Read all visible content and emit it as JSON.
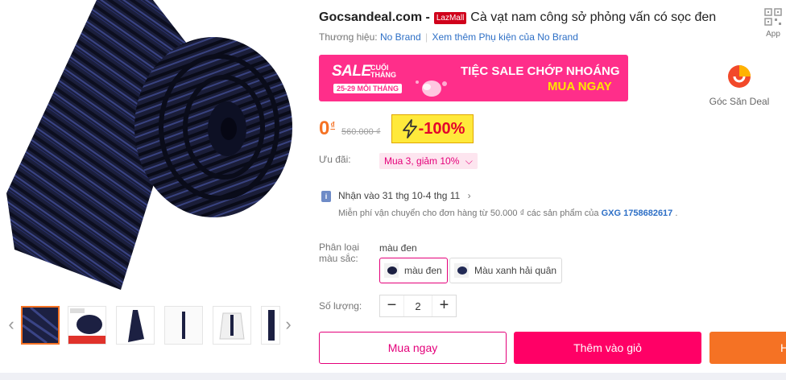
{
  "product": {
    "brand_name": "Gocsandeal.com -",
    "lazmall_badge": "LazMall",
    "title": "Cà vạt nam công sở phỏng vấn có sọc đen"
  },
  "app_shortcut": {
    "label": "App",
    "icon": "qr-code-icon"
  },
  "brand_row": {
    "label": "Thương hiệu:",
    "brand_link": "No Brand",
    "separator": "|",
    "more_link": "Xem thêm Phụ kiện của No Brand"
  },
  "banner": {
    "sale_word": "SALE",
    "sale_sub": "CUỐI THÁNG",
    "sale_date": "25-29 MỖI THÁNG",
    "headline": "TIỆC SALE CHỚP NHOÁNG",
    "cta": "MUA NGAY",
    "background_color": "#ff2e8a"
  },
  "seller": {
    "name": "Góc Săn Deal"
  },
  "price": {
    "current": "0",
    "currency": "₫",
    "original": "560.000 ₫",
    "discount": "-100%",
    "flash_icon": "lightning-icon"
  },
  "promotion": {
    "label": "Ưu đãi:",
    "chip": "Mua 3, giảm 10%"
  },
  "delivery": {
    "text": "Nhận vào 31 thg 10-4 thg 11",
    "shipping_prefix": "Miễn phí vận chuyển cho đơn hàng từ 50.000 ₫ các sản phẩm của",
    "shipping_code": "GXG 1758682617",
    "shipping_suffix": "."
  },
  "variants": {
    "label": "Phân loại màu sắc:",
    "selected_label": "màu đen",
    "options": [
      {
        "label": "màu đen",
        "selected": true
      },
      {
        "label": "Màu xanh hải quân",
        "selected": false
      }
    ]
  },
  "quantity": {
    "label": "Số lượng:",
    "value": "2",
    "minus": "−",
    "plus": "+"
  },
  "actions": {
    "buy_now": "Mua ngay",
    "add_to_cart": "Thêm vào giỏ",
    "extra": "H"
  },
  "colors": {
    "accent_pink": "#e4007a",
    "cart_pink": "#ff0066",
    "price_orange": "#f57224",
    "link_blue": "#2d6fc6"
  }
}
